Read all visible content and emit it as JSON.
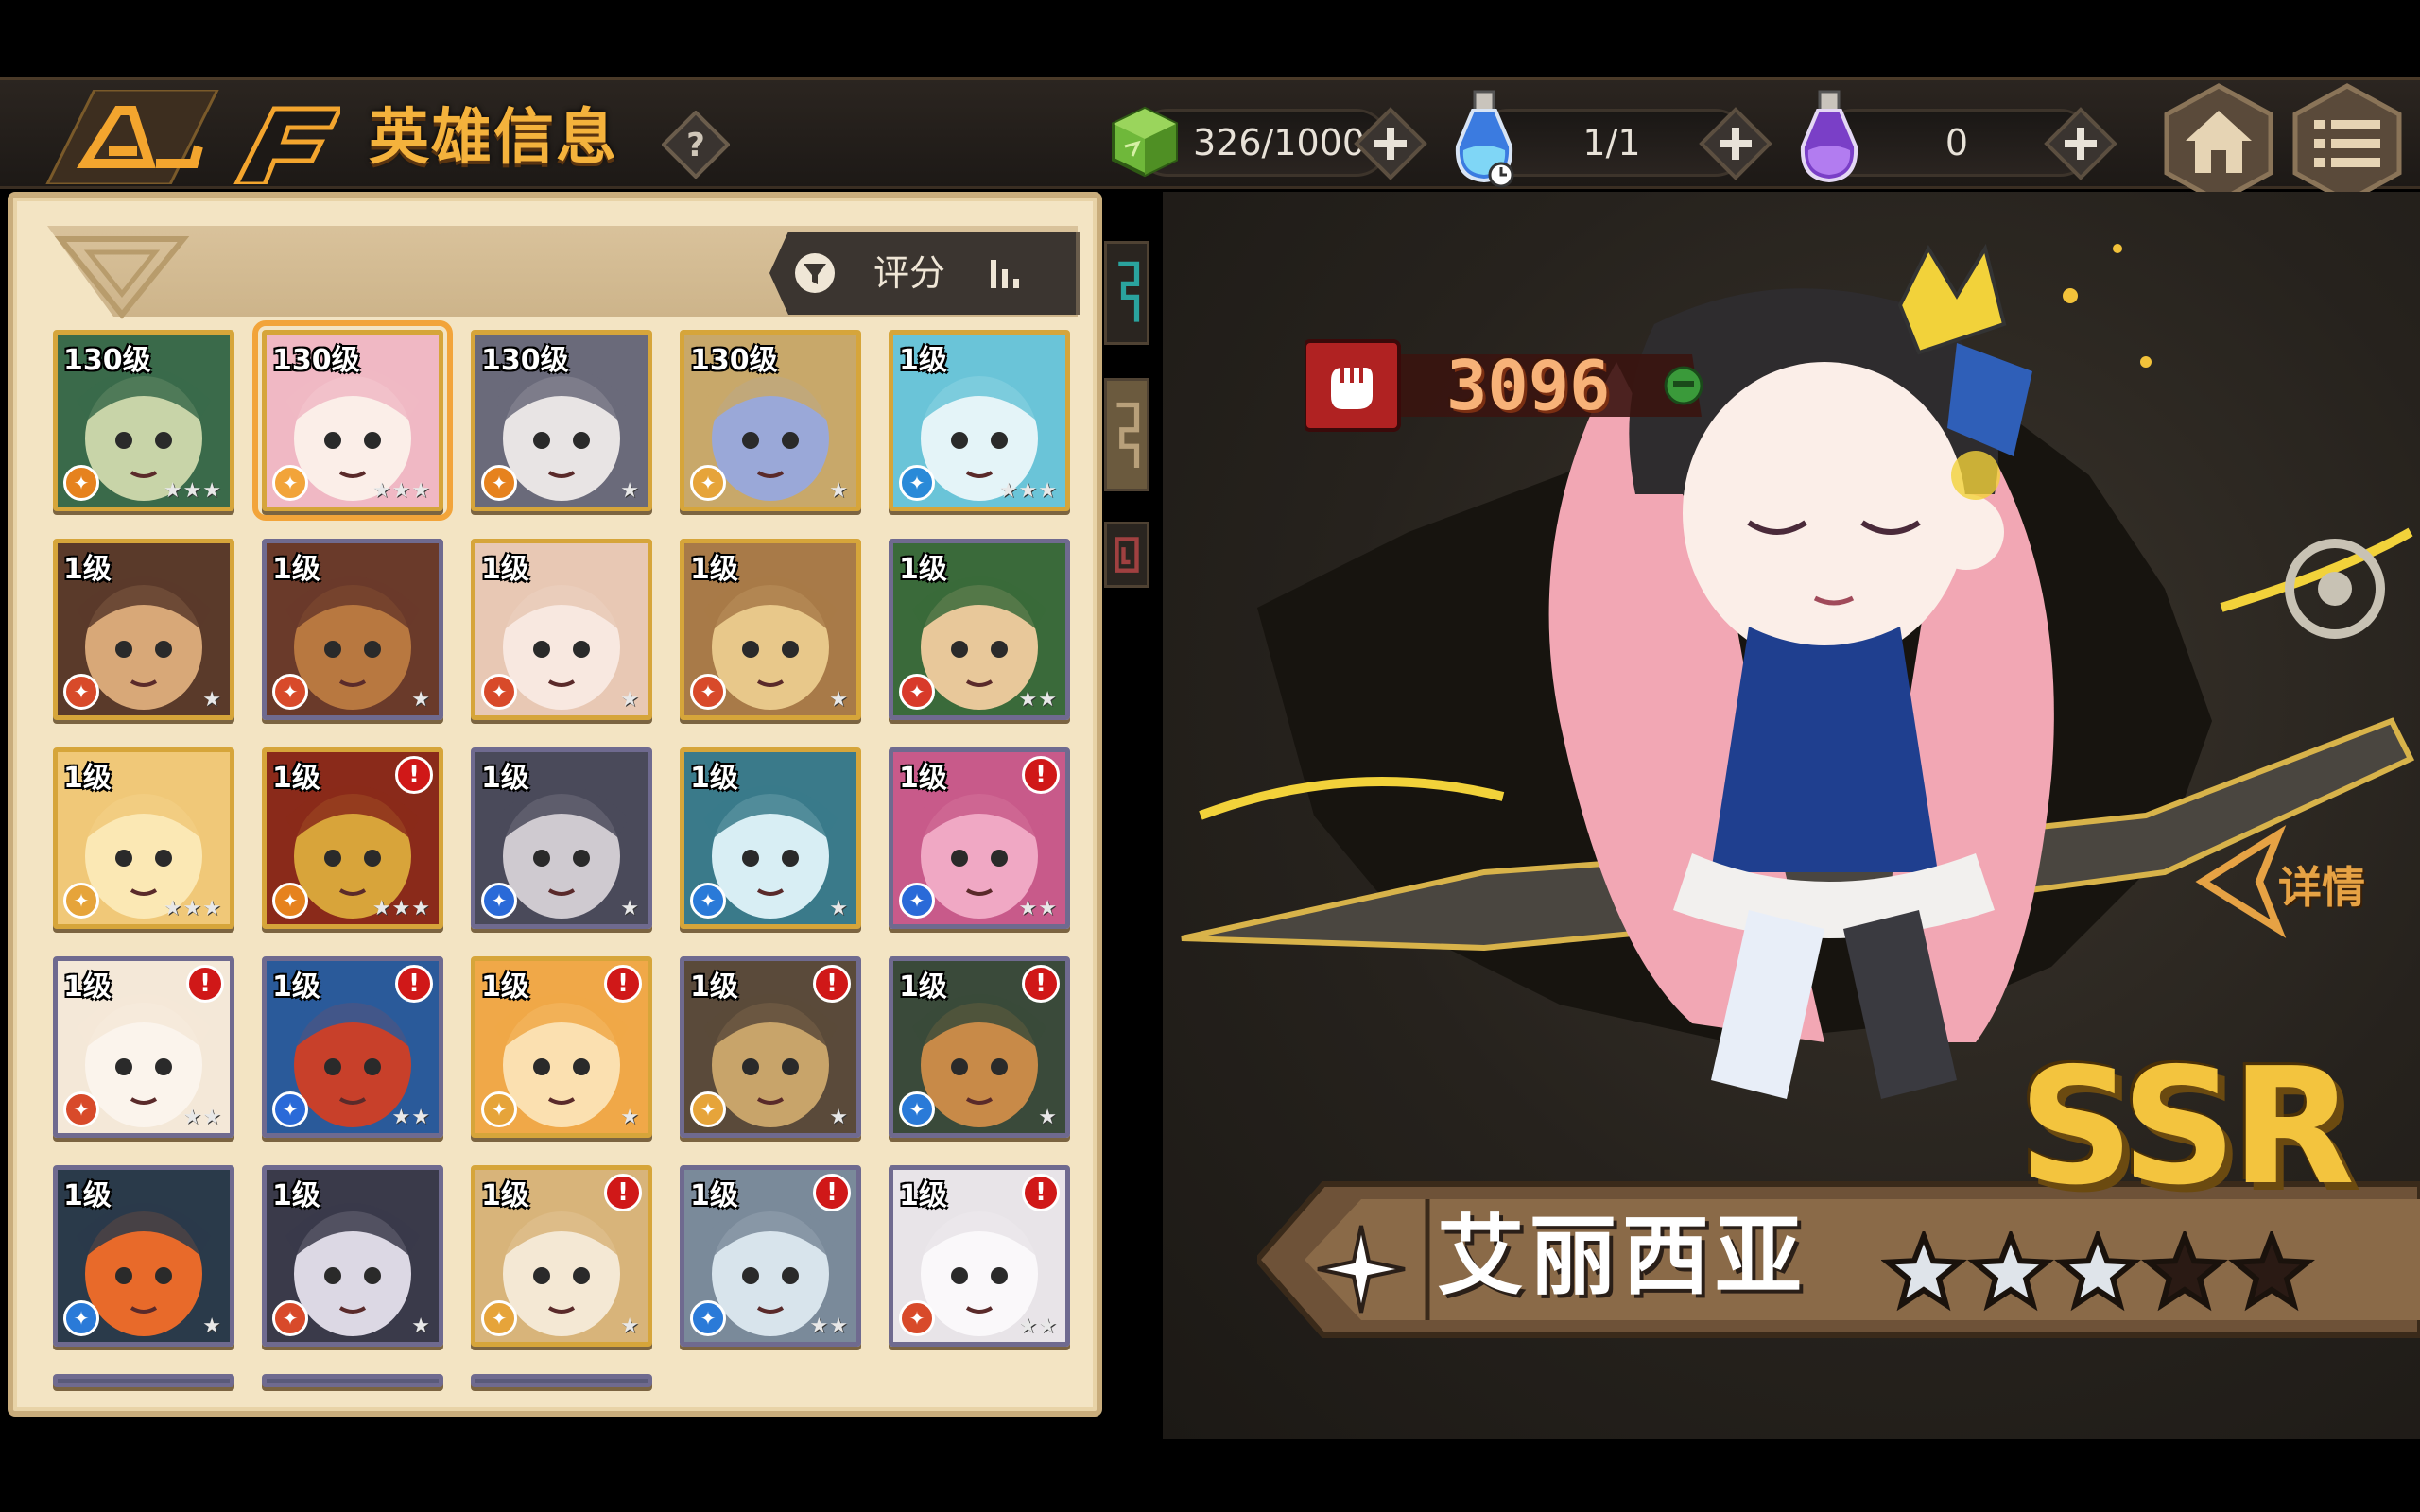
{
  "header": {
    "title": "英雄信息",
    "help_icon": "question-icon",
    "resources": [
      {
        "name": "stamina",
        "icon": "green-cube-icon",
        "value": "326/1000"
      },
      {
        "name": "blue-potion",
        "icon": "blue-potion-icon",
        "value": "1/1"
      },
      {
        "name": "purple-potion",
        "icon": "purple-potion-icon",
        "value": "0"
      }
    ],
    "home_icon": "home-icon",
    "menu_icon": "menu-icon"
  },
  "filter": {
    "sort_label": "评分",
    "filter_icon": "funnel-icon",
    "sort_icon": "bar-sort-icon"
  },
  "heroes": [
    {
      "level": "130级",
      "stars": 3,
      "alert": false,
      "frame": "gold",
      "selected": false
    },
    {
      "level": "130级",
      "stars": 3,
      "alert": false,
      "frame": "gold",
      "selected": true
    },
    {
      "level": "130级",
      "stars": 1,
      "alert": false,
      "frame": "gold",
      "selected": false
    },
    {
      "level": "130级",
      "stars": 1,
      "alert": false,
      "frame": "gold",
      "selected": false
    },
    {
      "level": "1级",
      "stars": 3,
      "alert": false,
      "frame": "gold",
      "selected": false
    },
    {
      "level": "1级",
      "stars": 1,
      "alert": false,
      "frame": "gold",
      "selected": false
    },
    {
      "level": "1级",
      "stars": 1,
      "alert": false,
      "frame": "purple",
      "selected": false
    },
    {
      "level": "1级",
      "stars": 1,
      "alert": false,
      "frame": "gold",
      "selected": false
    },
    {
      "level": "1级",
      "stars": 1,
      "alert": false,
      "frame": "gold",
      "selected": false
    },
    {
      "level": "1级",
      "stars": 2,
      "alert": false,
      "frame": "purple",
      "selected": false
    },
    {
      "level": "1级",
      "stars": 3,
      "alert": false,
      "frame": "gold",
      "selected": false
    },
    {
      "level": "1级",
      "stars": 3,
      "alert": true,
      "frame": "gold",
      "selected": false
    },
    {
      "level": "1级",
      "stars": 1,
      "alert": false,
      "frame": "purple",
      "selected": false
    },
    {
      "level": "1级",
      "stars": 1,
      "alert": false,
      "frame": "gold",
      "selected": false
    },
    {
      "level": "1级",
      "stars": 2,
      "alert": true,
      "frame": "purple",
      "selected": false
    },
    {
      "level": "1级",
      "stars": 2,
      "alert": true,
      "frame": "purple",
      "selected": false
    },
    {
      "level": "1级",
      "stars": 2,
      "alert": true,
      "frame": "purple",
      "selected": false
    },
    {
      "level": "1级",
      "stars": 1,
      "alert": true,
      "frame": "gold",
      "selected": false
    },
    {
      "level": "1级",
      "stars": 1,
      "alert": true,
      "frame": "purple",
      "selected": false
    },
    {
      "level": "1级",
      "stars": 1,
      "alert": true,
      "frame": "purple",
      "selected": false
    },
    {
      "level": "1级",
      "stars": 1,
      "alert": false,
      "frame": "purple",
      "selected": false
    },
    {
      "level": "1级",
      "stars": 1,
      "alert": false,
      "frame": "purple",
      "selected": false
    },
    {
      "level": "1级",
      "stars": 1,
      "alert": true,
      "frame": "gold",
      "selected": false
    },
    {
      "level": "1级",
      "stars": 2,
      "alert": true,
      "frame": "purple",
      "selected": false
    },
    {
      "level": "1级",
      "stars": 2,
      "alert": true,
      "frame": "purple",
      "selected": false
    }
  ],
  "detail": {
    "power": "3096",
    "power_icon": "fist-icon",
    "detail_label": "详情",
    "rarity": "SSR",
    "name": "艾丽西亚",
    "class_icon": "cross-star-icon",
    "stars_filled": 3,
    "stars_total": 5
  },
  "colors": {
    "accent_orange": "#f4b23c",
    "panel_bg": "#f3e4c3",
    "dark_bg": "#26221d",
    "alert_red": "#d01818"
  }
}
